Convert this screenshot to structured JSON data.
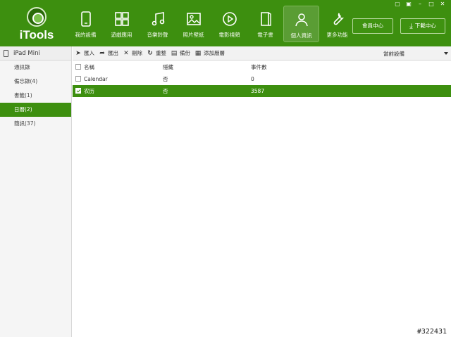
{
  "app": {
    "title": "iTools"
  },
  "nav": [
    {
      "label": "我的設備",
      "icon": "phone-icon"
    },
    {
      "label": "遊戲應用",
      "icon": "apps-grid-icon"
    },
    {
      "label": "音樂鈴聲",
      "icon": "music-note-icon"
    },
    {
      "label": "照片壁紙",
      "icon": "picture-icon"
    },
    {
      "label": "電影視頻",
      "icon": "play-circle-icon"
    },
    {
      "label": "電子書",
      "icon": "book-icon"
    },
    {
      "label": "個人資訊",
      "icon": "person-icon",
      "active": true
    },
    {
      "label": "更多功能",
      "icon": "wrench-icon"
    }
  ],
  "window_controls": [
    "shirt-icon",
    "box-icon",
    "minimize-icon",
    "maximize-icon",
    "close-icon"
  ],
  "header_buttons": {
    "member": "會員中心",
    "download": "下載中心"
  },
  "sidebar": {
    "device": "iPad Mini",
    "items": [
      {
        "label": "通訊錄"
      },
      {
        "label": "備忘錄(4)"
      },
      {
        "label": "書籤(1)"
      },
      {
        "label": "日曆(2)",
        "active": true
      },
      {
        "label": "簡訊(37)"
      }
    ]
  },
  "toolbar": {
    "import": "匯入",
    "export": "匯出",
    "delete": "刪除",
    "refresh": "重整",
    "backup": "備份",
    "add_calendar": "添加曆層",
    "device_select": "當前設備"
  },
  "table": {
    "columns": [
      "名稱",
      "隱藏",
      "事件數"
    ],
    "rows": [
      {
        "name": "Calendar",
        "hidden": "否",
        "events": "0",
        "checked": false,
        "selected": false
      },
      {
        "name": "农历",
        "hidden": "否",
        "events": "3587",
        "checked": true,
        "selected": true
      }
    ]
  },
  "watermark": "#322431",
  "colors": {
    "brand_green": "#3d8f0f",
    "sidebar_bg": "#f5f5f5",
    "toolbar_bg": "#f2f2f2"
  }
}
